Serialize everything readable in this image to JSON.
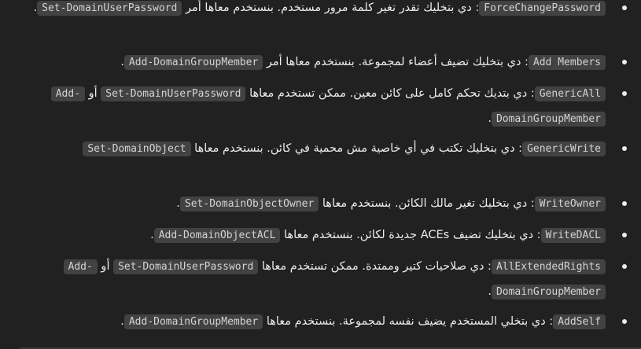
{
  "items": [
    {
      "term": "ForceChangePassword",
      "desc": ": دي بتخليك تقدر تغير كلمة مرور مستخدم. بنستخدم معاها أمر ",
      "code1": "Set-DomainUserPassword",
      "end": "."
    },
    {
      "term": "Add Members",
      "desc": ": دي بتخليك تضيف أعضاء لمجموعة. بنستخدم معاها أمر ",
      "code1": "Add-DomainGroupMember",
      "end": "."
    },
    {
      "term": "GenericAll",
      "desc": ": دي بتديك تحكم كامل على كائن معين. ممكن تستخدم معاها ",
      "code1": "Set-DomainUserPassword",
      "joiner": " أو ",
      "code2": "Add-DomainGroupMember",
      "end": "."
    },
    {
      "term": "GenericWrite",
      "desc": ": دي بتخليك تكتب في أي خاصية مش محمية في كائن. بنستخدم معاها ",
      "code1": "Set-DomainObject",
      "end": ""
    },
    {
      "term": "WriteOwner",
      "desc": ": دي بتخليك تغير مالك الكائن. بنستخدم معاها ",
      "code1": "Set-DomainObjectOwner",
      "end": "."
    },
    {
      "term": "WriteDACL",
      "desc": ": دي بتخليك تضيف ACEs جديدة لكائن. بنستخدم معاها ",
      "code1": "Add-DomainObjectACL",
      "end": "."
    },
    {
      "term": "AllExtendedRights",
      "desc": ": دي صلاحيات كتير وممتدة. ممكن تستخدم معاها ",
      "code1": "Set-DomainUserPassword",
      "joiner": " أو ",
      "code2": "Add-DomainGroupMember",
      "end": "."
    },
    {
      "term": "AddSelf",
      "desc": ": دي بتخلي المستخدم يضيف نفسه لمجموعة. بنستخدم معاها ",
      "code1": "Add-DomainGroupMember",
      "end": "."
    }
  ]
}
